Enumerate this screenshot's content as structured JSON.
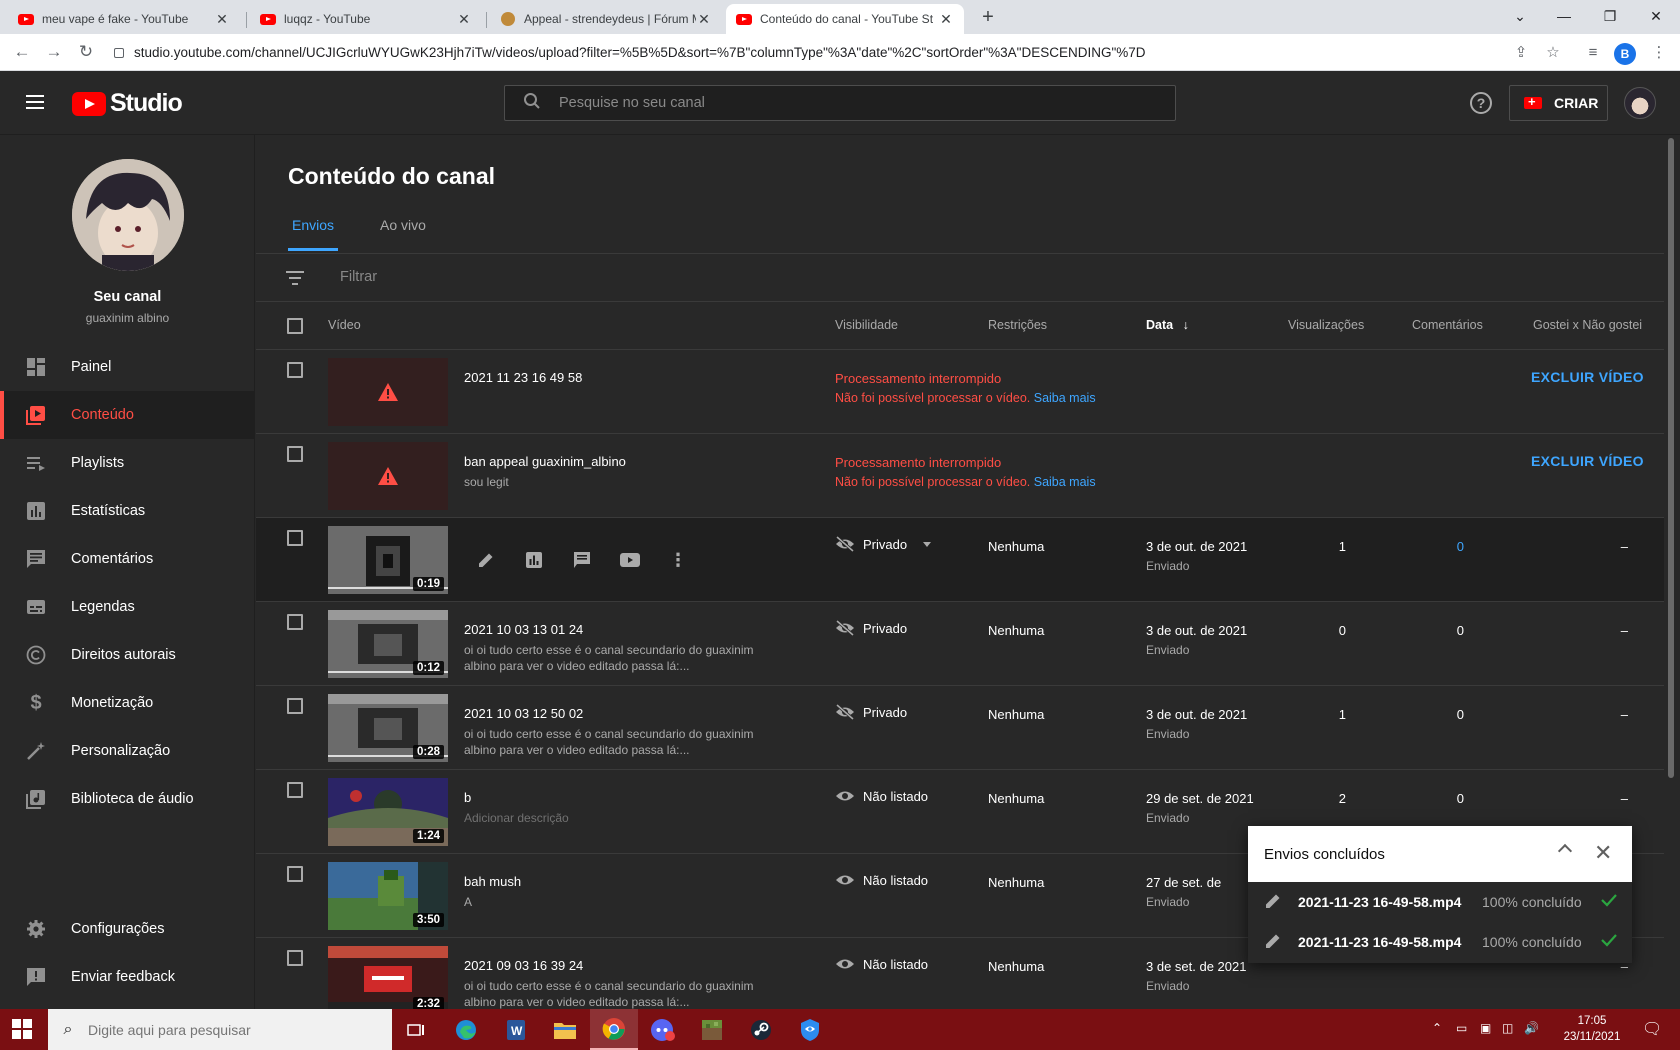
{
  "browser": {
    "tabs": [
      {
        "title": "meu vape é fake - YouTube",
        "active": false
      },
      {
        "title": "luqqz - YouTube",
        "active": false
      },
      {
        "title": "Appeal - strendeydeus | Fórum M",
        "active": false
      },
      {
        "title": "Conteúdo do canal - YouTube St",
        "active": true
      }
    ],
    "url": "studio.youtube.com/channel/UCJIGcrluWYUGwK23Hjh7iTw/videos/upload?filter=%5B%5D&sort=%7B\"columnType\"%3A\"date\"%2C\"sortOrder\"%3A\"DESCENDING\"%7D",
    "profile_initial": "B"
  },
  "header": {
    "logo_text": "Studio",
    "search_placeholder": "Pesquise no seu canal",
    "create_label": "CRIAR",
    "help_glyph": "?"
  },
  "sidebar": {
    "channel_title": "Seu canal",
    "channel_handle": "guaxinim albino",
    "items": [
      {
        "label": "Painel",
        "icon": "dashboard-icon"
      },
      {
        "label": "Conteúdo",
        "icon": "content-icon",
        "active": true
      },
      {
        "label": "Playlists",
        "icon": "playlists-icon"
      },
      {
        "label": "Estatísticas",
        "icon": "analytics-icon"
      },
      {
        "label": "Comentários",
        "icon": "comments-icon"
      },
      {
        "label": "Legendas",
        "icon": "subtitles-icon"
      },
      {
        "label": "Direitos autorais",
        "icon": "copyright-icon"
      },
      {
        "label": "Monetização",
        "icon": "monetization-icon"
      },
      {
        "label": "Personalização",
        "icon": "customization-icon"
      },
      {
        "label": "Biblioteca de áudio",
        "icon": "audio-library-icon"
      }
    ],
    "bottom_items": [
      {
        "label": "Configurações",
        "icon": "settings-icon"
      },
      {
        "label": "Enviar feedback",
        "icon": "feedback-icon"
      }
    ]
  },
  "main": {
    "title": "Conteúdo do canal",
    "tabs": [
      {
        "label": "Envios",
        "active": true
      },
      {
        "label": "Ao vivo",
        "active": false
      }
    ],
    "filter_placeholder": "Filtrar",
    "columns": {
      "video": "Vídeo",
      "visibility": "Visibilidade",
      "restrictions": "Restrições",
      "date": "Data",
      "views": "Visualizações",
      "comments": "Comentários",
      "likes": "Gostei x Não gostei"
    },
    "error_rows": [
      {
        "title": "2021 11 23 16 49 58",
        "desc": "",
        "status": "Processamento interrompido",
        "detail": "Não foi possível processar o vídeo.",
        "link": "Saiba mais",
        "action": "EXCLUIR VÍDEO"
      },
      {
        "title": "ban appeal guaxinim_albino",
        "desc": "sou legit",
        "status": "Processamento interrompido",
        "detail": "Não foi possível processar o vídeo.",
        "link": "Saiba mais",
        "action": "EXCLUIR VÍDEO"
      }
    ],
    "rows": [
      {
        "title": "",
        "desc": "",
        "duration": "0:19",
        "visibility": "Privado",
        "restrictions": "Nenhuma",
        "date": "3 de out. de 2021",
        "date_sub": "Enviado",
        "views": "1",
        "comments": "0",
        "likes": "–",
        "hover": true
      },
      {
        "title": "2021 10 03 13 01 24",
        "desc": "oi oi tudo certo esse é o canal secundario do guaxinim albino para ver o video editado passa lá:...",
        "duration": "0:12",
        "visibility": "Privado",
        "restrictions": "Nenhuma",
        "date": "3 de out. de 2021",
        "date_sub": "Enviado",
        "views": "0",
        "comments": "0",
        "likes": "–"
      },
      {
        "title": "2021 10 03 12 50 02",
        "desc": "oi oi tudo certo esse é o canal secundario do guaxinim albino para ver o video editado passa lá:...",
        "duration": "0:28",
        "visibility": "Privado",
        "restrictions": "Nenhuma",
        "date": "3 de out. de 2021",
        "date_sub": "Enviado",
        "views": "1",
        "comments": "0",
        "likes": "–"
      },
      {
        "title": "b",
        "desc": "Adicionar descrição",
        "duration": "1:24",
        "visibility": "Não listado",
        "restrictions": "Nenhuma",
        "date": "29 de set. de 2021",
        "date_sub": "Enviado",
        "views": "2",
        "comments": "0",
        "likes": "–"
      },
      {
        "title": "bah mush",
        "desc": "A",
        "duration": "3:50",
        "visibility": "Não listado",
        "restrictions": "Nenhuma",
        "date": "27 de set. de",
        "date_sub": "Enviado",
        "views": "",
        "comments": "",
        "likes": ""
      },
      {
        "title": "2021 09 03 16 39 24",
        "desc": "oi oi tudo certo esse é o canal secundario do guaxinim albino para ver o video editado passa lá:...",
        "duration": "2:32",
        "visibility": "Não listado",
        "restrictions": "Nenhuma",
        "date": "3 de set. de 2021",
        "date_sub": "Enviado",
        "views": "",
        "comments": "",
        "likes": "–"
      }
    ]
  },
  "upload_panel": {
    "title": "Envios concluídos",
    "items": [
      {
        "file": "2021-11-23 16-49-58.mp4",
        "status": "100% concluído"
      },
      {
        "file": "2021-11-23 16-49-58.mp4",
        "status": "100% concluído"
      }
    ]
  },
  "taskbar": {
    "search_placeholder": "Digite aqui para pesquisar",
    "time": "17:05",
    "date": "23/11/2021"
  },
  "colors": {
    "accent_blue": "#3ea6ff",
    "error_red": "#ff4e45",
    "brand_red": "#ff0000",
    "taskbar": "#7a0f12"
  }
}
